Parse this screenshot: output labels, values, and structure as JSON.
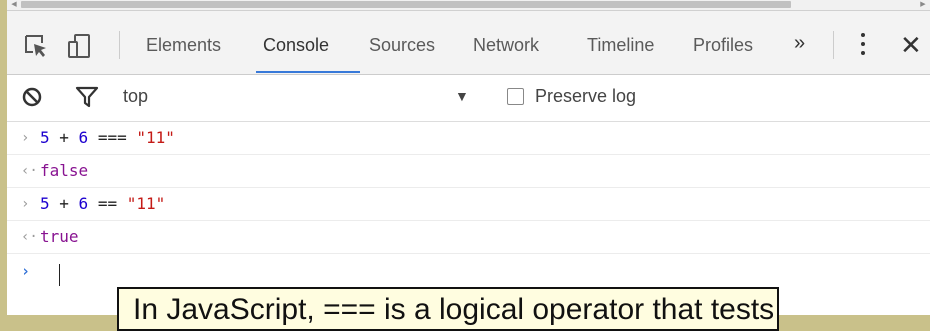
{
  "devtools": {
    "tabs": [
      {
        "label": "Elements"
      },
      {
        "label": "Console"
      },
      {
        "label": "Sources"
      },
      {
        "label": "Network"
      },
      {
        "label": "Timeline"
      },
      {
        "label": "Profiles"
      }
    ],
    "more_tabs_glyph": "»",
    "close_glyph": "✕",
    "active_tab": "Console"
  },
  "console_toolbar": {
    "context": "top",
    "dropdown_glyph": "▼",
    "preserve_log_label": "Preserve log",
    "preserve_log_checked": false
  },
  "console": {
    "entries": [
      {
        "type": "input",
        "marker": "›",
        "left": "5",
        "op1": " + ",
        "right": "6",
        "op2": " === ",
        "str": "\"11\""
      },
      {
        "type": "output",
        "marker": "‹·",
        "value": "false"
      },
      {
        "type": "input",
        "marker": "›",
        "left": "5",
        "op1": " + ",
        "right": "6",
        "op2": " == ",
        "str": "\"11\""
      },
      {
        "type": "output",
        "marker": "‹·",
        "value": "true"
      }
    ],
    "prompt_glyph": "›"
  },
  "caption": {
    "text": "In JavaScript, === is a logical operator that tests for"
  },
  "colors": {
    "accent": "#3879d9",
    "number": "#1c00cf",
    "string": "#c41a16",
    "boolean": "#881391"
  }
}
